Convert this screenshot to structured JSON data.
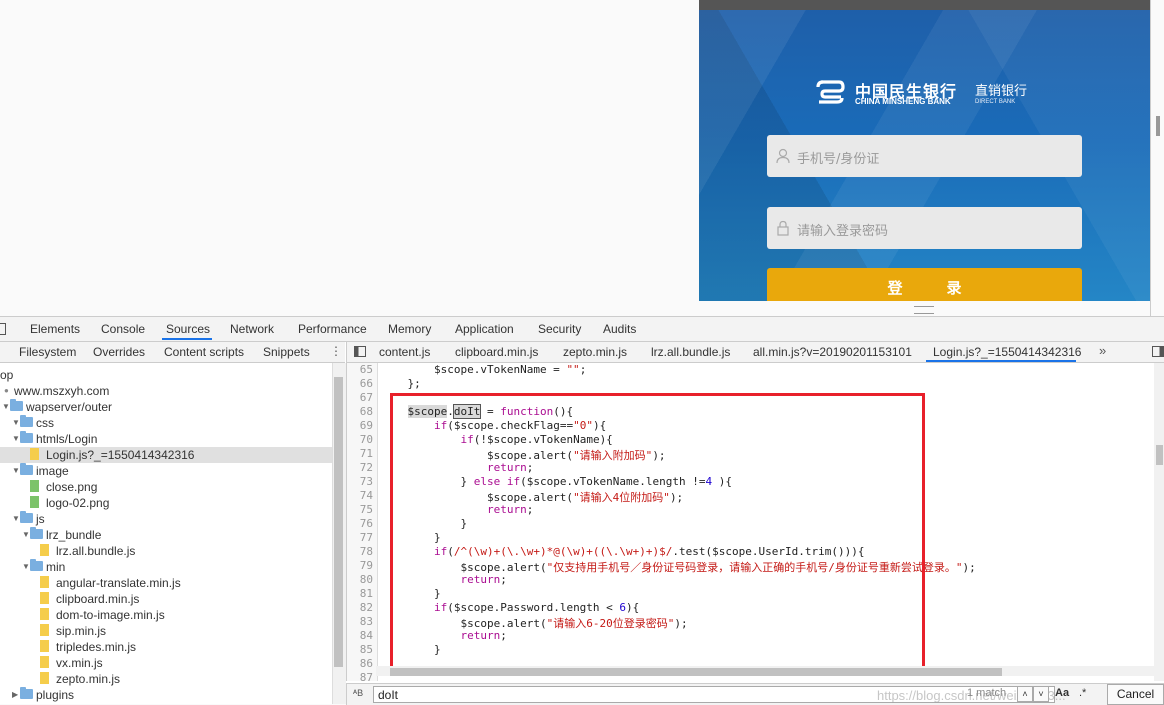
{
  "phone": {
    "bank_name_cn": "中国民生银行",
    "bank_name_en": "CHINA MINSHENG BANK",
    "bank_sub_cn": "直销银行",
    "bank_sub_en": "DIRECT BANK",
    "phone_placeholder": "手机号/身份证",
    "password_placeholder": "请输入登录密码",
    "login_label": "登录",
    "button_color": "#e9a80c",
    "bg_color": "#1d6ab5"
  },
  "devtools": {
    "main_tabs": [
      "Elements",
      "Console",
      "Sources",
      "Network",
      "Performance",
      "Memory",
      "Application",
      "Security",
      "Audits"
    ],
    "active_main_tab": "Sources",
    "sub_tabs": [
      "Filesystem",
      "Overrides",
      "Content scripts",
      "Snippets"
    ],
    "more_label": "⋮",
    "tree": [
      {
        "label": "op",
        "indent": 0,
        "kind": "root"
      },
      {
        "label": "www.mszxyh.com",
        "indent": 1,
        "kind": "domain"
      },
      {
        "label": "wapserver/outer",
        "indent": 1,
        "kind": "folder"
      },
      {
        "label": "css",
        "indent": 2,
        "kind": "folder"
      },
      {
        "label": "htmls/Login",
        "indent": 2,
        "kind": "folder"
      },
      {
        "label": "Login.js?_=1550414342316",
        "indent": 3,
        "kind": "file",
        "selected": true
      },
      {
        "label": "image",
        "indent": 2,
        "kind": "folder"
      },
      {
        "label": "close.png",
        "indent": 3,
        "kind": "img"
      },
      {
        "label": "logo-02.png",
        "indent": 3,
        "kind": "img"
      },
      {
        "label": "js",
        "indent": 2,
        "kind": "folder"
      },
      {
        "label": "lrz_bundle",
        "indent": 3,
        "kind": "folder"
      },
      {
        "label": "lrz.all.bundle.js",
        "indent": 4,
        "kind": "file"
      },
      {
        "label": "min",
        "indent": 3,
        "kind": "folder"
      },
      {
        "label": "angular-translate.min.js",
        "indent": 4,
        "kind": "file"
      },
      {
        "label": "clipboard.min.js",
        "indent": 4,
        "kind": "file"
      },
      {
        "label": "dom-to-image.min.js",
        "indent": 4,
        "kind": "file"
      },
      {
        "label": "sip.min.js",
        "indent": 4,
        "kind": "file"
      },
      {
        "label": "tripledes.min.js",
        "indent": 4,
        "kind": "file"
      },
      {
        "label": "vx.min.js",
        "indent": 4,
        "kind": "file"
      },
      {
        "label": "zepto.min.js",
        "indent": 4,
        "kind": "file"
      },
      {
        "label": "plugins",
        "indent": 2,
        "kind": "folder"
      }
    ],
    "editor_tabs": [
      "content.js",
      "clipboard.min.js",
      "zepto.min.js",
      "lrz.all.bundle.js",
      "all.min.js?v=20190201153101",
      "Login.js?_=1550414342316"
    ],
    "active_editor_tab": "Login.js?_=1550414342316",
    "tabs_overflow": "»",
    "code_lines": [
      {
        "n": "65",
        "html": "        $scope.vTokenName = <span class=\"str\">\"\"</span>;"
      },
      {
        "n": "66",
        "html": "    };"
      },
      {
        "n": "67",
        "html": ""
      },
      {
        "n": "68",
        "html": "    <span class=\"hl\">$scope</span>.<span class=\"hl2\">doIt</span> = <span class=\"kw\">function</span>(){"
      },
      {
        "n": "69",
        "html": "        <span class=\"kw\">if</span>($scope.checkFlag==<span class=\"str\">\"0\"</span>){"
      },
      {
        "n": "70",
        "html": "            <span class=\"kw\">if</span>(!$scope.vTokenName){"
      },
      {
        "n": "71",
        "html": "                $scope.alert(<span class=\"str\">\"请输入附加码\"</span>);"
      },
      {
        "n": "72",
        "html": "                <span class=\"kw\">return</span>;"
      },
      {
        "n": "73",
        "html": "            } <span class=\"kw\">else if</span>($scope.vTokenName.length !=<span class=\"num\">4</span> ){"
      },
      {
        "n": "74",
        "html": "                $scope.alert(<span class=\"str\">\"请输入4位附加码\"</span>);"
      },
      {
        "n": "75",
        "html": "                <span class=\"kw\">return</span>;"
      },
      {
        "n": "76",
        "html": "            }"
      },
      {
        "n": "77",
        "html": "        }"
      },
      {
        "n": "78",
        "html": "        <span class=\"kw\">if</span>(<span class=\"str\">/^(\\w)+(\\.\\w+)*@(\\w)+((\\.\\w+)+)$/</span>.test($scope.UserId.trim())){"
      },
      {
        "n": "79",
        "html": "            $scope.alert(<span class=\"str\">\"仅支持用手机号／身份证号码登录，请输入正确的手机号/身份证号重新尝试登录。\"</span>);"
      },
      {
        "n": "80",
        "html": "            <span class=\"kw\">return</span>;"
      },
      {
        "n": "81",
        "html": "        }"
      },
      {
        "n": "82",
        "html": "        <span class=\"kw\">if</span>($scope.Password.length &lt; <span class=\"num\">6</span>){"
      },
      {
        "n": "83",
        "html": "            $scope.alert(<span class=\"str\">\"请输入6-20位登录密码\"</span>);"
      },
      {
        "n": "84",
        "html": "            <span class=\"kw\">return</span>;"
      },
      {
        "n": "85",
        "html": "        }"
      },
      {
        "n": "86",
        "html": ""
      },
      {
        "n": "87",
        "html": ""
      }
    ],
    "search": {
      "value": "doIt",
      "match_count": "1 match",
      "prev": "˄",
      "next": "˅",
      "case_label": "Aa",
      "regex_label": ".*",
      "cancel_label": "Cancel",
      "regex_icon": "ᴬB"
    },
    "watermark": "https://blog.csdn.net/weixin_43...",
    "highlight_box_color": "#e8202a"
  }
}
